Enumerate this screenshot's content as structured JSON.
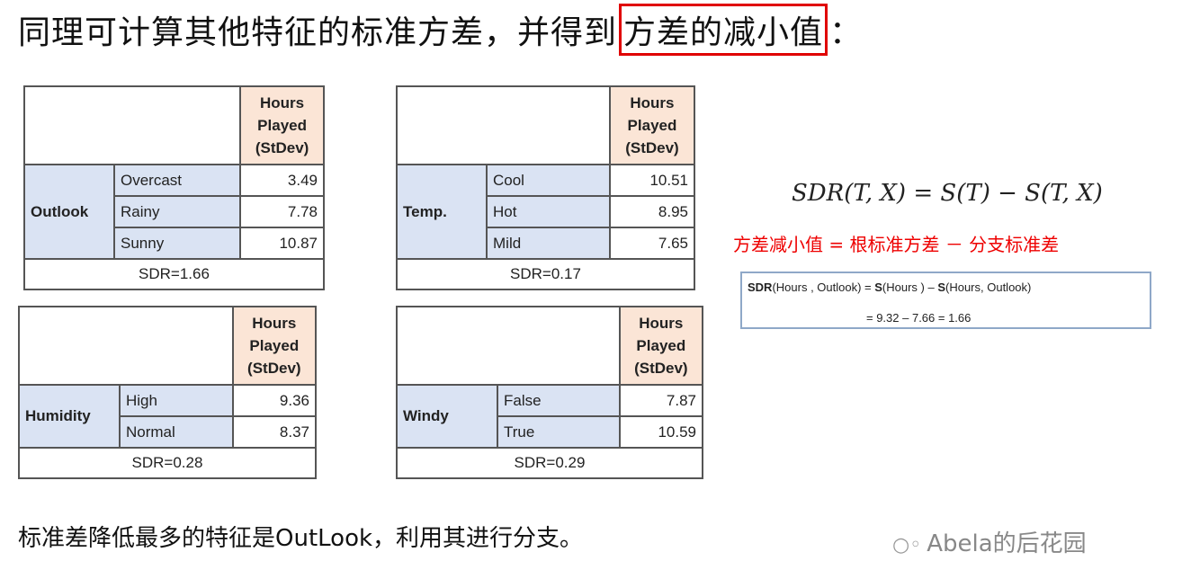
{
  "title": {
    "prefix": "同理可计算其他特征的标准方差，并得到",
    "highlight": "方差的减小值",
    "suffix": "："
  },
  "header_label": {
    "line1": "Hours",
    "line2": "Played",
    "line3": "(StDev)"
  },
  "tables": {
    "outlook": {
      "feature": "Outlook",
      "rows": [
        {
          "label": "Overcast",
          "value": "3.49"
        },
        {
          "label": "Rainy",
          "value": "7.78"
        },
        {
          "label": "Sunny",
          "value": "10.87"
        }
      ],
      "sdr": "SDR=1.66"
    },
    "temp": {
      "feature": "Temp.",
      "rows": [
        {
          "label": "Cool",
          "value": "10.51"
        },
        {
          "label": "Hot",
          "value": "8.95"
        },
        {
          "label": "Mild",
          "value": "7.65"
        }
      ],
      "sdr": "SDR=0.17"
    },
    "humidity": {
      "feature": "Humidity",
      "rows": [
        {
          "label": "High",
          "value": "9.36"
        },
        {
          "label": "Normal",
          "value": "8.37"
        }
      ],
      "sdr": "SDR=0.28"
    },
    "windy": {
      "feature": "Windy",
      "rows": [
        {
          "label": "False",
          "value": "7.87"
        },
        {
          "label": "True",
          "value": "10.59"
        }
      ],
      "sdr": "SDR=0.29"
    }
  },
  "formula": "SDR(T, X) = S(T) − S(T, X)",
  "formula_cn": "方差减小值 = 根标准方差 － 分支标准差",
  "calc": {
    "sdr_bold": "SDR",
    "part1": "(Hours , Outlook) = ",
    "s1_bold": "S",
    "part2": "(Hours ) – ",
    "s2_bold": "S",
    "part3": "(Hours, Outlook)",
    "line2": "= 9.32 – 7.66 = 1.66"
  },
  "conclusion": "标准差降低最多的特征是OutLook，利用其进行分支。",
  "watermark": "Abela的后花园",
  "watermark_icon": "wechat-icon"
}
